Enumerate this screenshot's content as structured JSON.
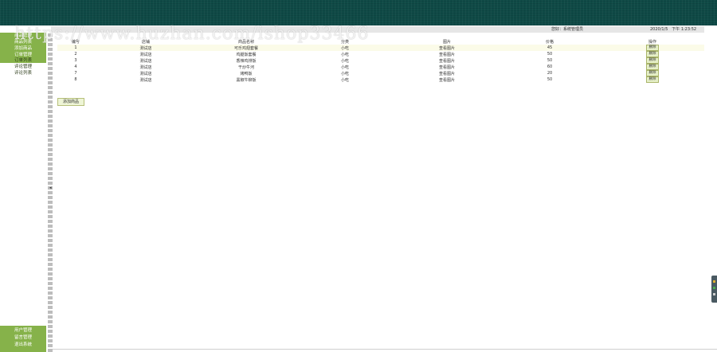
{
  "header": {
    "info_user": "您好：系统管理员",
    "info_datetime": "2020/1/5   下午 1:23:52"
  },
  "watermark": "https://www.huzhan.com/ishop33466",
  "sidebar": {
    "top_items": [
      "商品管理",
      "商品列表",
      "添加商品",
      "订单管理",
      "订单列表"
    ],
    "mid_items": [
      "评论管理",
      "评论列表"
    ],
    "bottom_items": [
      "用户管理",
      "留言管理",
      "退出系统"
    ]
  },
  "table": {
    "headers": [
      "编号",
      "店铺",
      "商品名称",
      "分类",
      "图片",
      "价格",
      "操作"
    ],
    "rows": [
      [
        "1",
        "测试店",
        "可乐鸡翅套餐",
        "小吃",
        "查看图片",
        "45",
        "删除"
      ],
      [
        "2",
        "测试店",
        "鸡腿饭套餐",
        "小吃",
        "查看图片",
        "50",
        "删除"
      ],
      [
        "3",
        "测试店",
        "香辣鸡排饭",
        "小吃",
        "查看图片",
        "50",
        "删除"
      ],
      [
        "4",
        "测试店",
        "干炒牛河",
        "小吃",
        "查看图片",
        "60",
        "删除"
      ],
      [
        "7",
        "测试店",
        "烤鸭饭",
        "小吃",
        "查看图片",
        "20",
        "删除"
      ],
      [
        "8",
        "测试店",
        "黑椒牛柳饭",
        "小吃",
        "查看图片",
        "50",
        "删除"
      ]
    ]
  },
  "add_button": "添加商品",
  "colors": {
    "topbar": "#0f4a46",
    "sidebar_accent": "#86b24a",
    "button_bg": "#e6f0c8"
  }
}
